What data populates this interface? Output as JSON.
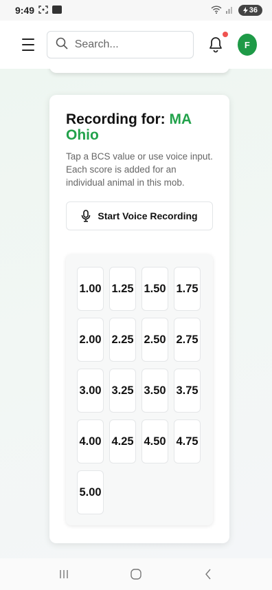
{
  "status_bar": {
    "time": "9:49",
    "battery": "36"
  },
  "header": {
    "search_placeholder": "Search...",
    "avatar_initial": "F",
    "notification_dot_color": "#ef5350",
    "avatar_color": "#1e9a47"
  },
  "card": {
    "title_prefix": "Recording for: ",
    "mob_name": "MA Ohio",
    "description": "Tap a BCS value or use voice input. Each score is added for an individual animal in this mob.",
    "voice_button_label": "Start Voice Recording",
    "accent_color": "#22a24b"
  },
  "bcs_values": [
    "1.00",
    "1.25",
    "1.50",
    "1.75",
    "2.00",
    "2.25",
    "2.50",
    "2.75",
    "3.00",
    "3.25",
    "3.50",
    "3.75",
    "4.00",
    "4.25",
    "4.50",
    "4.75",
    "5.00"
  ],
  "nav": {
    "icons": [
      "recent-apps-icon",
      "home-icon",
      "back-icon"
    ]
  }
}
